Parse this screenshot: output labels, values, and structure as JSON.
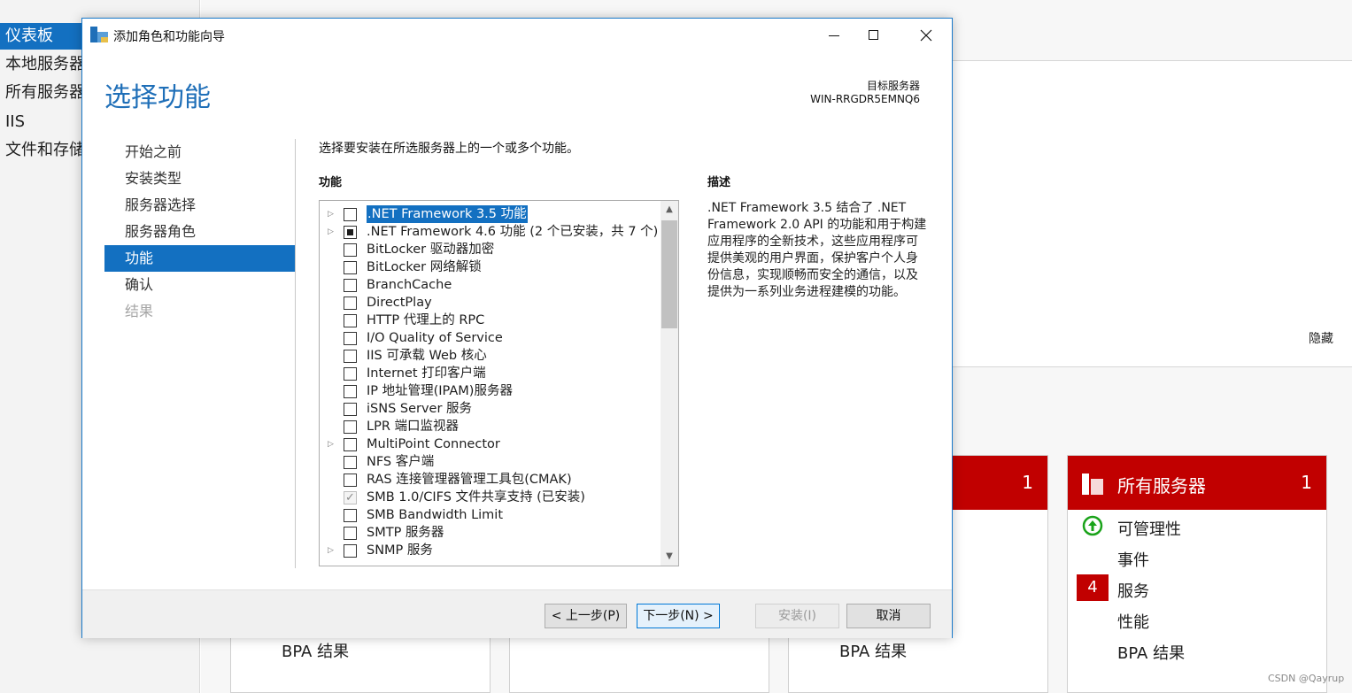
{
  "background": {
    "nav": [
      "仪表板",
      "本地服务器",
      "所有服务器",
      "IIS",
      "文件和存储"
    ],
    "hide_label": "隐藏",
    "tile_left": {
      "count": "1"
    },
    "tile_right": {
      "title": "所有服务器",
      "count": "1",
      "rows": {
        "manageability": "可管理性",
        "events": "事件",
        "services": "服务",
        "services_count": "4",
        "performance": "性能",
        "bpa": "BPA 结果"
      }
    },
    "bpa_label": "BPA 结果",
    "watermark": "CSDN @Qayrup",
    "colors": {
      "tile_red": "#c10000",
      "nav_active": "#1370c1"
    }
  },
  "wizard": {
    "window_title": "添加角色和功能向导",
    "page_title": "选择功能",
    "target_server_label": "目标服务器",
    "target_server_value": "WIN-RRGDR5EMNQ6",
    "steps": [
      {
        "label": "开始之前",
        "state": "normal"
      },
      {
        "label": "安装类型",
        "state": "normal"
      },
      {
        "label": "服务器选择",
        "state": "normal"
      },
      {
        "label": "服务器角色",
        "state": "normal"
      },
      {
        "label": "功能",
        "state": "active"
      },
      {
        "label": "确认",
        "state": "normal"
      },
      {
        "label": "结果",
        "state": "disabled"
      }
    ],
    "instruction": "选择要安装在所选服务器上的一个或多个功能。",
    "features_heading": "功能",
    "features": [
      {
        "label": ".NET Framework 3.5 功能",
        "expandable": true,
        "state": "unchecked",
        "selected": true
      },
      {
        "label": ".NET Framework 4.6 功能 (2 个已安装，共 7 个)",
        "expandable": true,
        "state": "partial",
        "selected": false
      },
      {
        "label": "BitLocker 驱动器加密",
        "expandable": false,
        "state": "unchecked",
        "selected": false
      },
      {
        "label": "BitLocker 网络解锁",
        "expandable": false,
        "state": "unchecked",
        "selected": false
      },
      {
        "label": "BranchCache",
        "expandable": false,
        "state": "unchecked",
        "selected": false
      },
      {
        "label": "DirectPlay",
        "expandable": false,
        "state": "unchecked",
        "selected": false
      },
      {
        "label": "HTTP 代理上的 RPC",
        "expandable": false,
        "state": "unchecked",
        "selected": false
      },
      {
        "label": "I/O Quality of Service",
        "expandable": false,
        "state": "unchecked",
        "selected": false
      },
      {
        "label": "IIS 可承载 Web 核心",
        "expandable": false,
        "state": "unchecked",
        "selected": false
      },
      {
        "label": "Internet 打印客户端",
        "expandable": false,
        "state": "unchecked",
        "selected": false
      },
      {
        "label": "IP 地址管理(IPAM)服务器",
        "expandable": false,
        "state": "unchecked",
        "selected": false
      },
      {
        "label": "iSNS Server 服务",
        "expandable": false,
        "state": "unchecked",
        "selected": false
      },
      {
        "label": "LPR 端口监视器",
        "expandable": false,
        "state": "unchecked",
        "selected": false
      },
      {
        "label": "MultiPoint Connector",
        "expandable": true,
        "state": "unchecked",
        "selected": false
      },
      {
        "label": "NFS 客户端",
        "expandable": false,
        "state": "unchecked",
        "selected": false
      },
      {
        "label": "RAS 连接管理器管理工具包(CMAK)",
        "expandable": false,
        "state": "unchecked",
        "selected": false
      },
      {
        "label": "SMB 1.0/CIFS 文件共享支持 (已安装)",
        "expandable": false,
        "state": "checked",
        "selected": false
      },
      {
        "label": "SMB Bandwidth Limit",
        "expandable": false,
        "state": "unchecked",
        "selected": false
      },
      {
        "label": "SMTP 服务器",
        "expandable": false,
        "state": "unchecked",
        "selected": false
      },
      {
        "label": "SNMP 服务",
        "expandable": true,
        "state": "unchecked",
        "selected": false
      }
    ],
    "description_heading": "描述",
    "description": ".NET Framework 3.5 结合了 .NET Framework 2.0 API 的功能和用于构建应用程序的全新技术，这些应用程序可提供美观的用户界面，保护客户个人身份信息，实现顺畅而安全的通信，以及提供为一系列业务进程建模的功能。",
    "buttons": {
      "prev": "< 上一步(P)",
      "next": "下一步(N) >",
      "install": "安装(I)",
      "cancel": "取消"
    },
    "colors": {
      "accent": "#1f6fb8",
      "selection": "#1370c1"
    }
  }
}
